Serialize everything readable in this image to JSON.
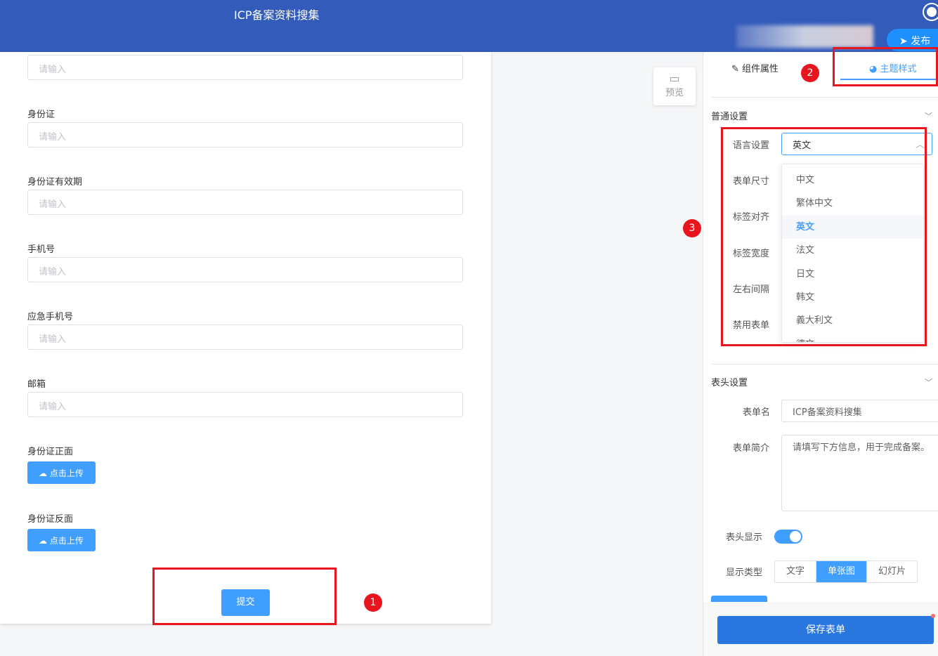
{
  "header": {
    "title": "ICP备案资料搜集",
    "publish": "发布"
  },
  "form": {
    "top_placeholder": "请输入",
    "fields": [
      {
        "label": "身份证",
        "placeholder": "请输入"
      },
      {
        "label": "身份证有效期",
        "placeholder": "请输入"
      },
      {
        "label": "手机号",
        "placeholder": "请输入"
      },
      {
        "label": "应急手机号",
        "placeholder": "请输入"
      },
      {
        "label": "邮箱",
        "placeholder": "请输入"
      }
    ],
    "uploads": [
      {
        "label": "身份证正面",
        "button": "点击上传"
      },
      {
        "label": "身份证反面",
        "button": "点击上传"
      }
    ],
    "submit": "提交"
  },
  "preview": "预览",
  "badges": [
    "1",
    "2",
    "3"
  ],
  "panel": {
    "tabs": [
      "组件属性",
      "主题样式"
    ],
    "general": "普通设置",
    "labels": [
      "语言设置",
      "表单尺寸",
      "标签对齐",
      "标签宽度",
      "左右间隔",
      "禁用表单"
    ],
    "language": "英文",
    "options": [
      "中文",
      "繁体中文",
      "英文",
      "法文",
      "日文",
      "韩文",
      "義大利文",
      "德文"
    ],
    "header_section": "表头设置",
    "form_name_label": "表单名",
    "form_name": "ICP备案资料搜集",
    "form_desc_label": "表单简介",
    "form_desc": "请填写下方信息，用于完成备案。",
    "show_header_label": "表头显示",
    "display_type_label": "显示类型",
    "display_types": [
      "文字",
      "单张图",
      "幻灯片"
    ],
    "save": "保存表单"
  },
  "colors": {
    "header": "#325bba",
    "primary": "#409eff",
    "annotation": "#e8141e"
  }
}
